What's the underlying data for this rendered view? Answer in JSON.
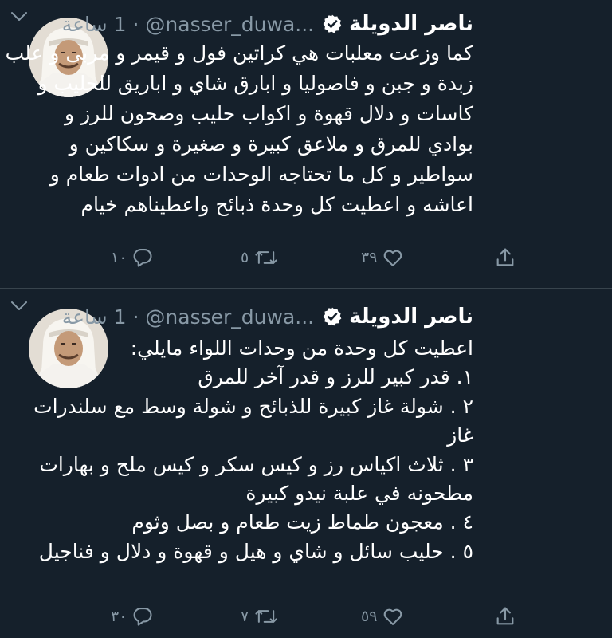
{
  "colors": {
    "background": "#15202b",
    "text": "#ffffff",
    "secondary": "#8899a6",
    "divider": "#38444d"
  },
  "tweets": [
    {
      "author_name": "ناصر الدويلة",
      "verified_icon": "verified-badge-icon",
      "handle": "@nasser_duwa...",
      "separator": "·",
      "time": "1 ساعة",
      "menu_icon": "chevron-down-icon",
      "lines": [
        "كما وزعت معلبات هي كراتين فول و قيمر و مربى و علب",
        "زبدة و جبن و فاصوليا و ابارق شاي و اباريق للحليب و",
        "كاسات و دلال قهوة و اكواب حليب وصحون للرز و",
        "بوادي للمرق و ملاعق كبيرة و صغيرة و سكاكين و",
        "سواطير و كل ما تحتاجه الوحدات من ادوات طعام و",
        "اعاشه و اعطيت كل وحدة ذبائح واعطيناهم خيام"
      ],
      "replies": "١٠",
      "retweets": "٥",
      "likes": "٣٩"
    },
    {
      "author_name": "ناصر الدويلة",
      "verified_icon": "verified-badge-icon",
      "handle": "@nasser_duwa...",
      "separator": "·",
      "time": "1 ساعة",
      "menu_icon": "chevron-down-icon",
      "lines": [
        "اعطيت كل وحدة من وحدات اللواء مايلي:",
        "١. قدر كبير للرز و قدر آخر للمرق",
        "٢ . شولة غاز كبيرة للذبائح و شولة وسط مع سلندرات",
        "غاز",
        "٣ . ثلاث اكياس رز و كيس سكر و كيس ملح و بهارات",
        "مطحونه في علبة نيدو كبيرة",
        "٤ . معجون طماط زيت طعام و بصل وثوم",
        "٥ . حليب سائل و شاي و هيل و قهوة و دلال و فناجيل"
      ],
      "replies": "٣٠",
      "retweets": "٧",
      "likes": "٥٩"
    }
  ]
}
